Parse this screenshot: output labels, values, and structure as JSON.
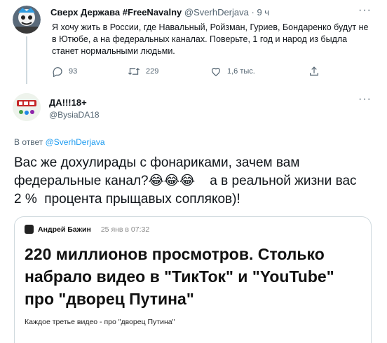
{
  "parent_tweet": {
    "display_name": "Сверх Держава #FreeNavalny",
    "handle": "@SverhDerjava",
    "separator": " · ",
    "time": "9 ч",
    "text": "Я хочу жить в России, где Навальный, Ройзман, Гуриев, Бондаренко будут не в Ютюбе, а на федеральных каналах. Поверьте, 1 год и народ из быдла станет нормальными людьми.",
    "replies": "93",
    "retweets": "229",
    "likes": "1,6 тыс.",
    "more_label": "···"
  },
  "reply_tweet": {
    "display_name": "ДА!!!18+",
    "handle": "@BysiaDA18",
    "more_label": "···",
    "reply_prefix": "В ответ",
    "reply_handle": "@SverhDerjava",
    "text_part1": "Вас же  дохулирады с фонариками, зачем вам федеральные канал?",
    "emojis": "😂😂😂",
    "text_part2": "    а в реальной жизни вас 2 %  процента прыщавых сопляков)!"
  },
  "embedded_image": {
    "author": "Андрей Бажин",
    "date": "25 янв в 07:32",
    "headline": "220 миллионов просмотров. Столько набрало видео в \"ТикТок\" и \"YouTube\" про \"дворец Путина\"",
    "caption": "Каждое третье видео - про \"дворец Путина\""
  },
  "icons": {
    "reply": "reply-icon",
    "retweet": "retweet-icon",
    "like": "heart-icon",
    "share": "share-icon"
  },
  "colors": {
    "link": "#1d9bf0",
    "muted": "#536471",
    "border": "#cfd9de"
  }
}
